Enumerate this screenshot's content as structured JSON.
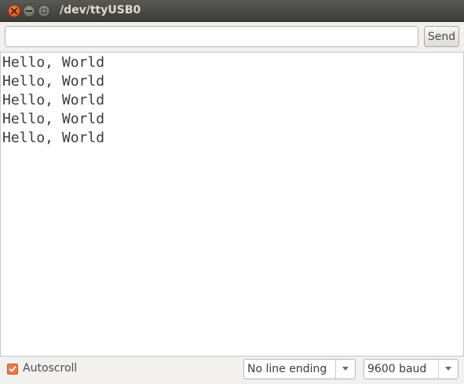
{
  "window": {
    "title": "/dev/ttyUSB0"
  },
  "input": {
    "value": "",
    "placeholder": ""
  },
  "send_button": {
    "label": "Send"
  },
  "output": {
    "lines": [
      "Hello, World",
      "Hello, World",
      "Hello, World",
      "Hello, World",
      "Hello, World"
    ]
  },
  "footer": {
    "autoscroll_label": "Autoscroll",
    "autoscroll_checked": true,
    "line_ending": "No line ending",
    "baud_rate": "9600 baud"
  },
  "colors": {
    "accent": "#f07746",
    "titlebar": "#3c3b37",
    "close_button": "#e0561e"
  },
  "icons": {
    "close": "close-icon",
    "minimize": "minimize-icon",
    "maximize": "maximize-icon",
    "dropdown": "chevron-down-icon",
    "check": "checkmark-icon"
  }
}
